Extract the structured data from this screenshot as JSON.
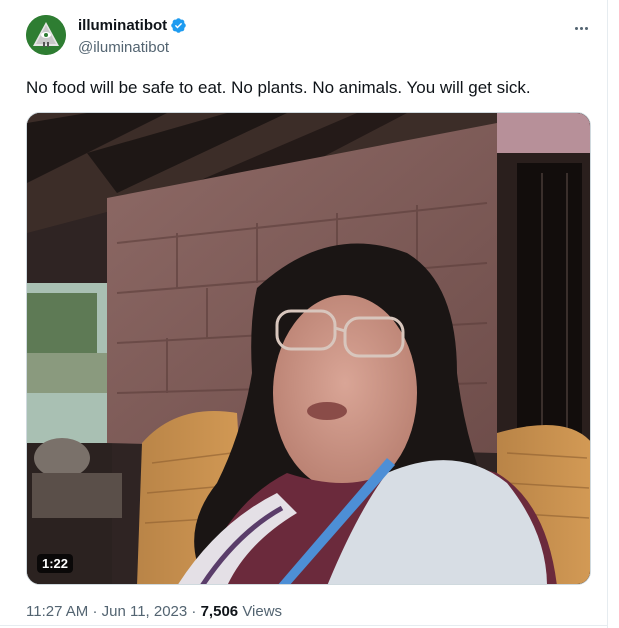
{
  "author": {
    "display_name": "illuminatibot",
    "handle": "@iluminatibot"
  },
  "tweet": {
    "text": "No food will be safe to eat. No plants. No animals. You will get sick."
  },
  "media": {
    "type": "video",
    "duration": "1:22"
  },
  "meta": {
    "time": "11:27 AM",
    "separator": "·",
    "date": "Jun 11, 2023",
    "views_count": "7,506",
    "views_label": "Views"
  },
  "icons": {
    "verified": "verified-badge-icon",
    "more": "more-options-icon"
  },
  "colors": {
    "verified_blue": "#1d9bf0",
    "secondary_text": "#536471",
    "primary_text": "#0f1419"
  }
}
